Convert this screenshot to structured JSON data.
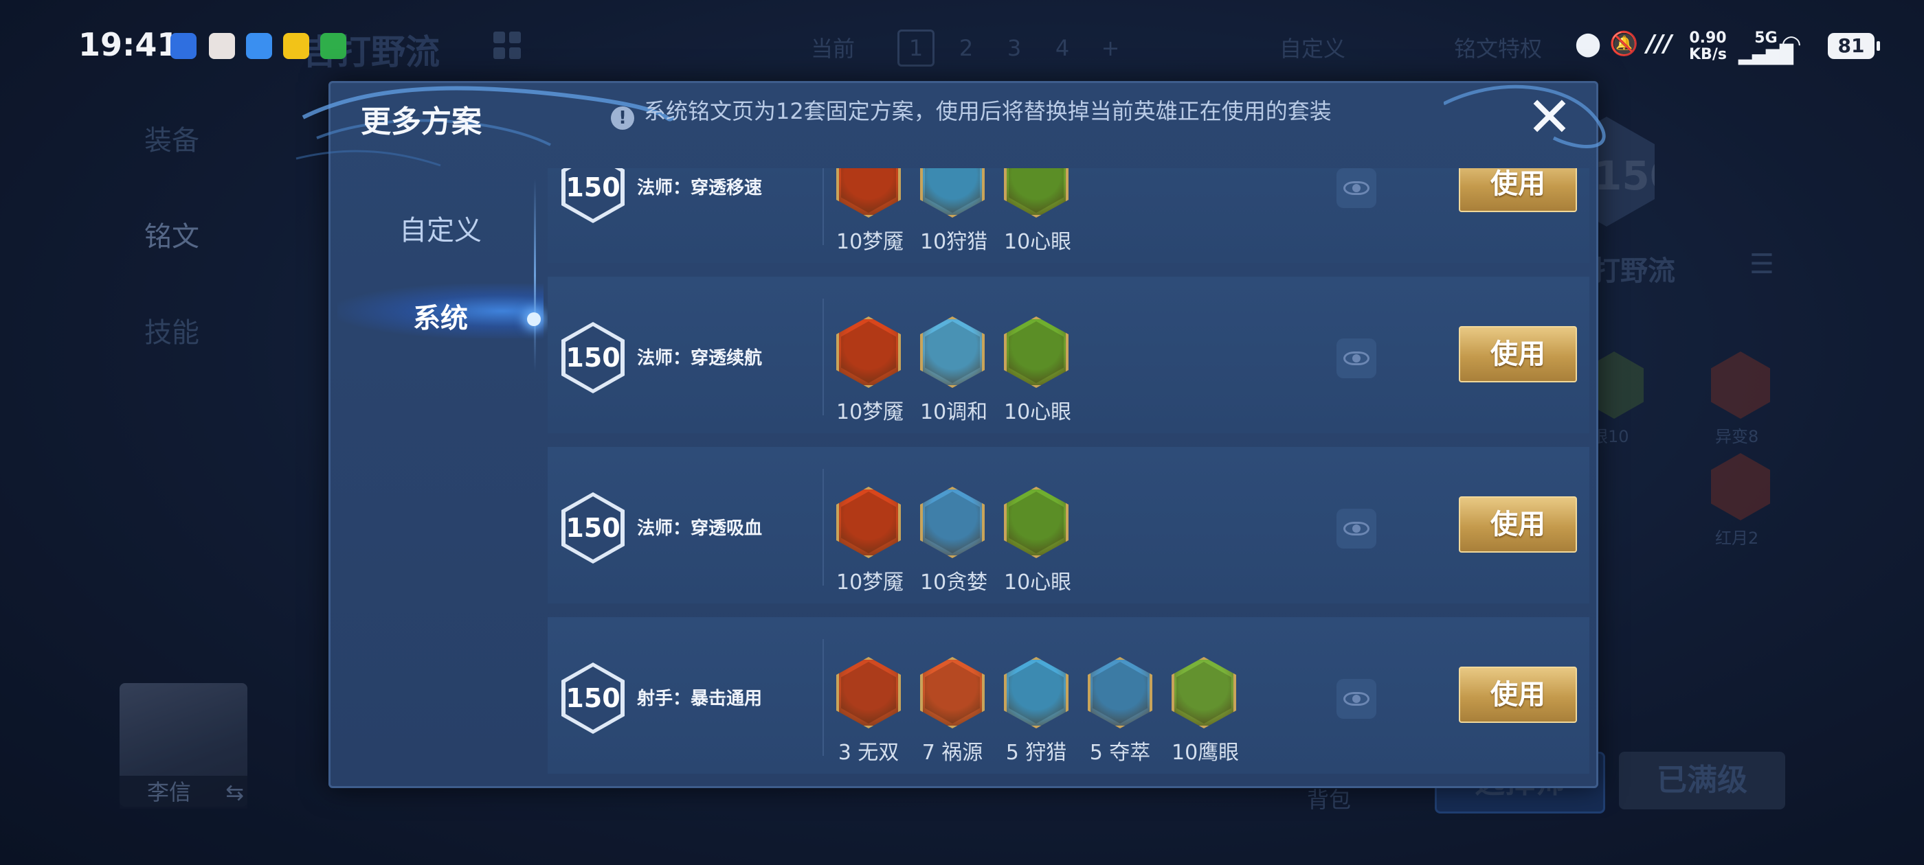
{
  "status_bar": {
    "time": "19:41",
    "net_speed": "0.90",
    "net_unit": "KB/s",
    "signal_label": "5G",
    "battery": "81"
  },
  "background": {
    "loadout_title": "吉打野流",
    "tabs_label": "当前",
    "tab_numbers": [
      "1",
      "2",
      "3",
      "4",
      "+"
    ],
    "custom": "自定义",
    "privilege": "铭文特权",
    "side_items": [
      "装备",
      "铭文",
      "技能"
    ],
    "level": "150",
    "right_title": "打野流",
    "right_runes": [
      "眼10",
      "异变8",
      "红月2"
    ],
    "hero_name": "李信",
    "bag": "背包",
    "btn_choose": "选择师",
    "btn_maxed": "已满级"
  },
  "modal": {
    "title": "更多方案",
    "info_text": "系统铭文页为12套固定方案，使用后将替换掉当前英雄正在使用的套装",
    "close_glyph": "✕",
    "nav": [
      {
        "label": "自定义",
        "active": false
      },
      {
        "label": "系统",
        "active": true
      }
    ],
    "use_label": "使用",
    "rows": [
      {
        "level": "150",
        "name": "法师：穿透移速",
        "runes": [
          {
            "label": "10梦魇",
            "color": "#d9461c"
          },
          {
            "label": "10狩猎",
            "color": "#4aa9d8"
          },
          {
            "label": "10心眼",
            "color": "#6fae2f"
          }
        ]
      },
      {
        "level": "150",
        "name": "法师：穿透续航",
        "runes": [
          {
            "label": "10梦魇",
            "color": "#d9461c"
          },
          {
            "label": "10调和",
            "color": "#5ab2dc"
          },
          {
            "label": "10心眼",
            "color": "#6fae2f"
          }
        ]
      },
      {
        "level": "150",
        "name": "法师：穿透吸血",
        "runes": [
          {
            "label": "10梦魇",
            "color": "#d9461c"
          },
          {
            "label": "10贪婪",
            "color": "#4d9bcf"
          },
          {
            "label": "10心眼",
            "color": "#6fae2f"
          }
        ]
      },
      {
        "level": "150",
        "name": "射手：暴击通用",
        "runes": [
          {
            "label": "3 无双",
            "color": "#d24a21"
          },
          {
            "label": "7 祸源",
            "color": "#de5a2a"
          },
          {
            "label": "5 狩猎",
            "color": "#4aa9d8"
          },
          {
            "label": "5 夺萃",
            "color": "#4a96c8"
          },
          {
            "label": "10鹰眼",
            "color": "#79b33a"
          }
        ]
      }
    ]
  }
}
